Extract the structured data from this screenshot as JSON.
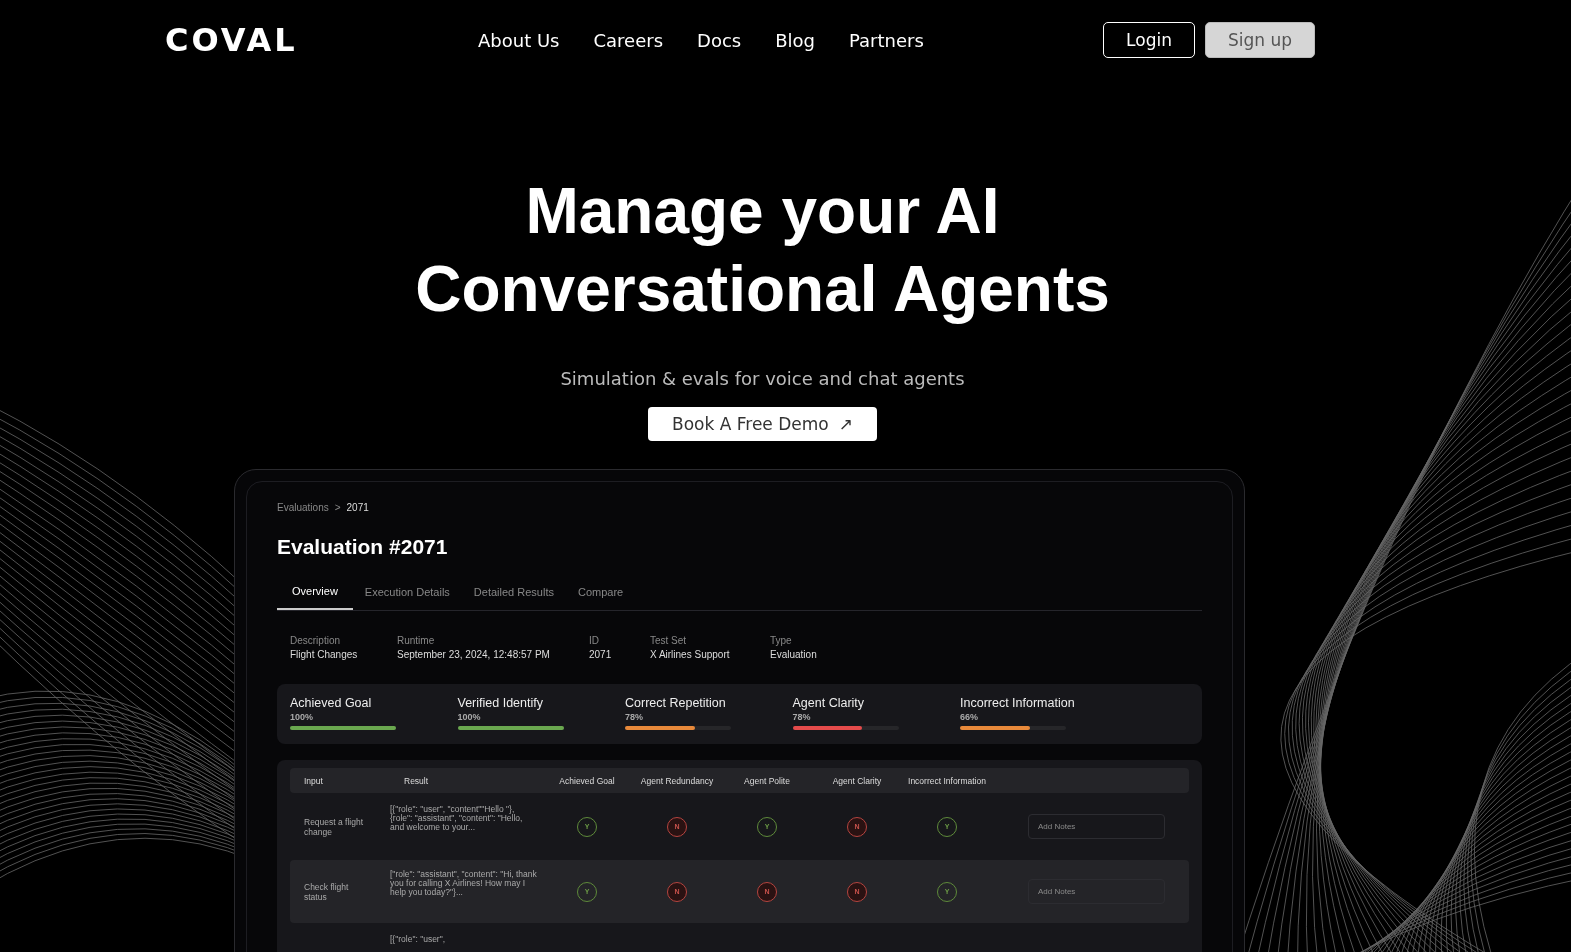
{
  "nav": {
    "logo": "COVAL",
    "links": [
      "About Us",
      "Careers",
      "Docs",
      "Blog",
      "Partners"
    ],
    "login": "Login",
    "signup": "Sign up"
  },
  "hero": {
    "title_lines": [
      "Manage your AI",
      "Conversational Agents"
    ],
    "subtitle": "Simulation & evals for voice and chat agents",
    "cta": "Book A Free Demo",
    "cta_icon": "↗"
  },
  "dashboard": {
    "breadcrumb": [
      "Evaluations",
      ">",
      "2071"
    ],
    "title": "Evaluation #2071",
    "tabs": [
      {
        "label": "Overview",
        "selected": true
      },
      {
        "label": "Execution Details",
        "selected": false
      },
      {
        "label": "Detailed Results",
        "selected": false
      },
      {
        "label": "Compare",
        "selected": false
      }
    ],
    "info": [
      {
        "label": "Description",
        "value": "Flight Changes"
      },
      {
        "label": "Runtime",
        "value": "September 23, 2024, 12:48:57 PM"
      },
      {
        "label": "ID",
        "value": "2071"
      },
      {
        "label": "Test Set",
        "value": "X Airlines Support"
      },
      {
        "label": "Type",
        "value": "Evaluation"
      }
    ],
    "metrics": [
      {
        "name": "Achieved Goal",
        "reading": "100%",
        "level": 1.0,
        "color": "#6aa84f"
      },
      {
        "name": "Verified Identify",
        "reading": "100%",
        "level": 1.0,
        "color": "#6aa84f"
      },
      {
        "name": "Correct Repetition",
        "reading": "78%",
        "level": 0.66,
        "color": "#e8893a"
      },
      {
        "name": "Agent Clarity",
        "reading": "78%",
        "level": 0.66,
        "color": "#e54b4b"
      },
      {
        "name": "Incorrect Information",
        "reading": "66%",
        "level": 0.66,
        "color": "#e8893a"
      }
    ],
    "table": {
      "columns": [
        "Input",
        "Result",
        "Achieved Goal",
        "Agent Redundancy",
        "Agent Polite",
        "Agent Clarity",
        "Incorrect Information"
      ],
      "rows": [
        {
          "input": "Request a flight change",
          "result": "[{\"role\": \"user\", \"content\"\"Hello \"}, {role\": \"assistant\", \"content\": \"Hello, and welcome to your...",
          "selected": false,
          "scores": [
            {
              "letter": "Y",
              "pass": true
            },
            {
              "letter": "N",
              "pass": false
            },
            {
              "letter": "Y",
              "pass": true
            },
            {
              "letter": "N",
              "pass": false
            },
            {
              "letter": "Y",
              "pass": true
            }
          ],
          "notes_placeholder": "Add Notes"
        },
        {
          "input": "Check flight status",
          "result": "[\"role\": \"assistant\", \"content\": \"Hi, thank you for calling X Airlines! How may I help you today?\"}...",
          "selected": true,
          "scores": [
            {
              "letter": "Y",
              "pass": true
            },
            {
              "letter": "N",
              "pass": false
            },
            {
              "letter": "N",
              "pass": false
            },
            {
              "letter": "N",
              "pass": false
            },
            {
              "letter": "Y",
              "pass": true
            }
          ],
          "notes_placeholder": "Add Notes"
        },
        {
          "result": "[{\"role\": \"user\",",
          "selected": false
        }
      ]
    }
  }
}
